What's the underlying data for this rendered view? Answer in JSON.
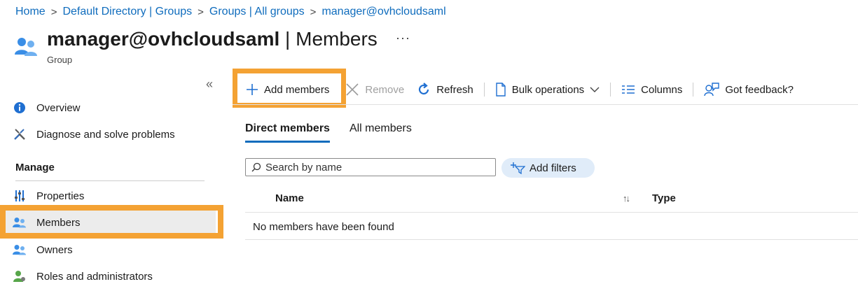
{
  "breadcrumb": {
    "items": [
      "Home",
      "Default Directory | Groups",
      "Groups | All groups",
      "manager@ovhcloudsaml"
    ],
    "separator": ">"
  },
  "header": {
    "title_bold": "manager@ovhcloudsaml",
    "title_rest": " | Members",
    "subtitle": "Group",
    "more_label": "···"
  },
  "sidebar": {
    "collapse_label": "«",
    "items": [
      {
        "label": "Overview",
        "icon": "info-icon"
      },
      {
        "label": "Diagnose and solve problems",
        "icon": "wrench-icon"
      }
    ],
    "manage_heading": "Manage",
    "manage_items": [
      {
        "label": "Properties",
        "icon": "properties-icon"
      },
      {
        "label": "Members",
        "icon": "members-icon",
        "active": true
      },
      {
        "label": "Owners",
        "icon": "owners-icon"
      },
      {
        "label": "Roles and administrators",
        "icon": "roles-icon"
      }
    ]
  },
  "toolbar": {
    "add_members": "Add members",
    "remove": "Remove",
    "refresh": "Refresh",
    "bulk_operations": "Bulk operations",
    "columns": "Columns",
    "feedback": "Got feedback?"
  },
  "tabs": [
    "Direct members",
    "All members"
  ],
  "search": {
    "placeholder": "Search by name"
  },
  "filters": {
    "label": "Add filters"
  },
  "table": {
    "columns": [
      "Name",
      "Type"
    ],
    "sort_icon": "↑↓",
    "empty_message": "No members have been found"
  },
  "colors": {
    "accent": "#0f6cbd",
    "highlight": "#f4a233",
    "filter_bg": "#e0ecf9"
  }
}
